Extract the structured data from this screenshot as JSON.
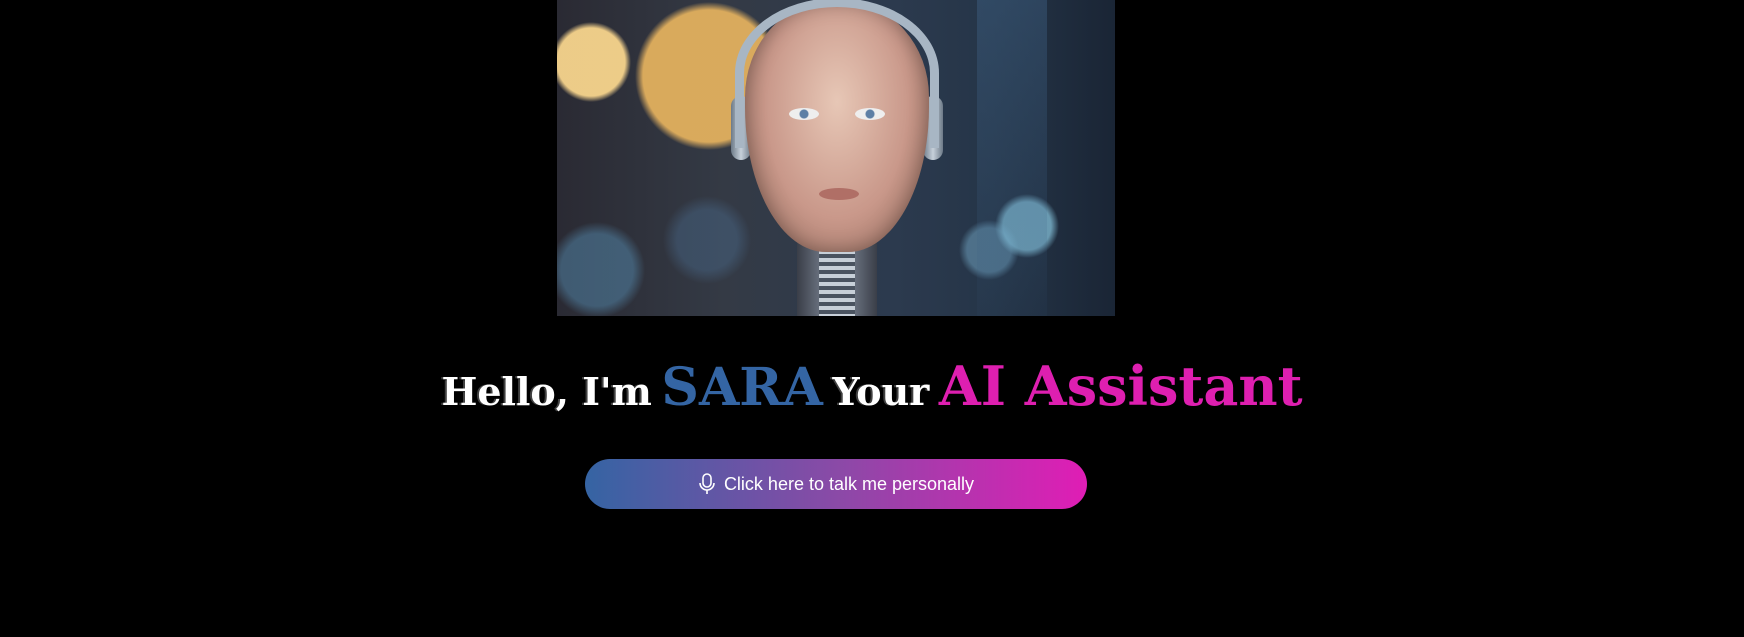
{
  "hero": {
    "image_icon": "robot-portrait-image"
  },
  "headline": {
    "part1": "Hello, I'm",
    "name": "SARA",
    "part2": "Your",
    "accent": "AI Assistant"
  },
  "talk_button": {
    "label": "Click here to talk me personally",
    "icon": "microphone-icon"
  },
  "colors": {
    "background": "#000000",
    "name_color": "#3465a4",
    "accent_color": "#de1fb0",
    "button_gradient_start": "#3564a3",
    "button_gradient_end": "#e01db5"
  }
}
